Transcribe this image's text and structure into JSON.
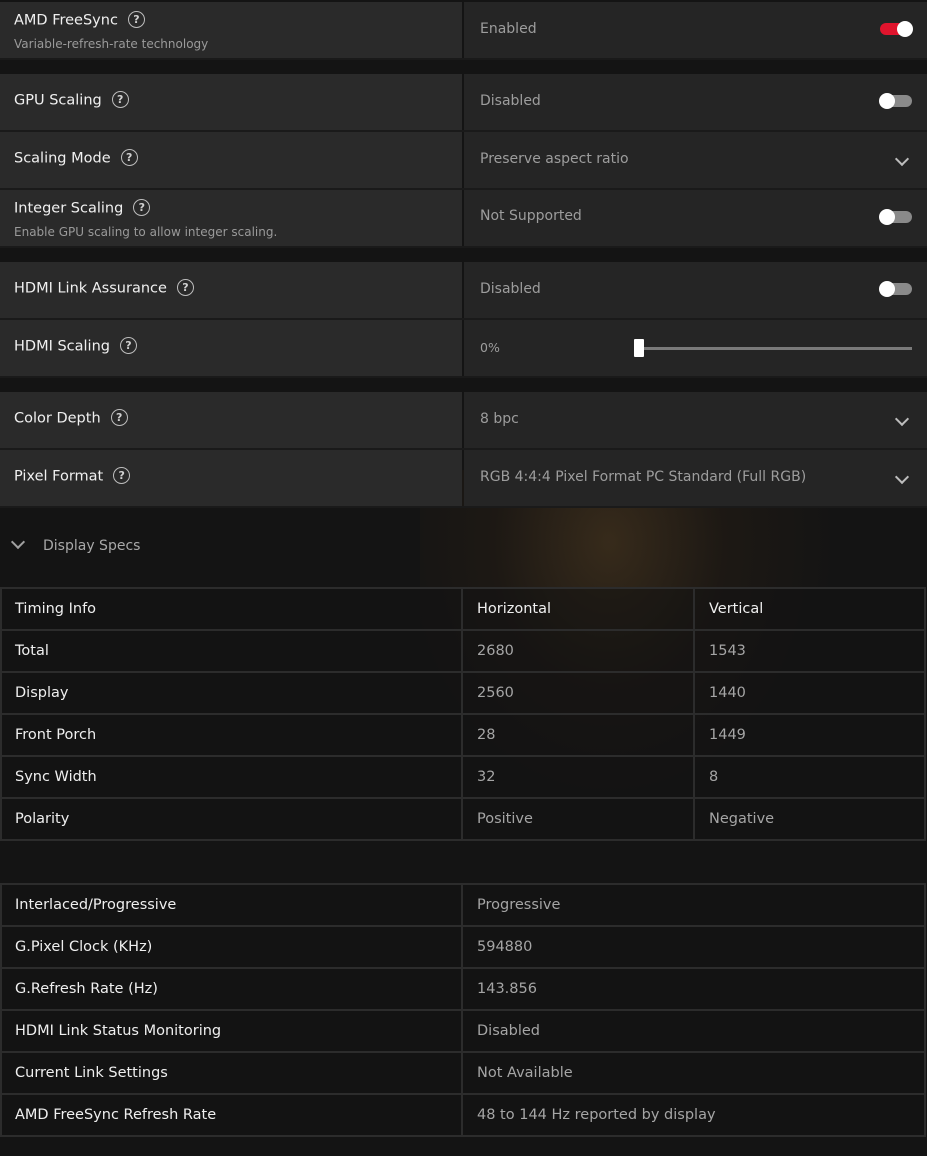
{
  "settings": {
    "freesync": {
      "title": "AMD FreeSync",
      "subtitle": "Variable-refresh-rate technology",
      "value": "Enabled",
      "toggle": "on"
    },
    "gpu_scaling": {
      "title": "GPU Scaling",
      "value": "Disabled",
      "toggle": "off"
    },
    "scaling_mode": {
      "title": "Scaling Mode",
      "value": "Preserve aspect ratio"
    },
    "integer_scaling": {
      "title": "Integer Scaling",
      "subtitle": "Enable GPU scaling to allow integer scaling.",
      "value": "Not Supported",
      "toggle": "off"
    },
    "hdmi_link_assurance": {
      "title": "HDMI Link Assurance",
      "value": "Disabled",
      "toggle": "off"
    },
    "hdmi_scaling": {
      "title": "HDMI Scaling",
      "value": "0%",
      "level": 0
    },
    "color_depth": {
      "title": "Color Depth",
      "value": "8 bpc"
    },
    "pixel_format": {
      "title": "Pixel Format",
      "value": "RGB 4:4:4 Pixel Format PC Standard (Full RGB)"
    }
  },
  "help_glyph": "?",
  "specs": {
    "title": "Display Specs",
    "timing": {
      "headers": [
        "Timing Info",
        "Horizontal",
        "Vertical"
      ],
      "rows": [
        [
          "Total",
          "2680",
          "1543"
        ],
        [
          "Display",
          "2560",
          "1440"
        ],
        [
          "Front Porch",
          "28",
          "1449"
        ],
        [
          "Sync Width",
          "32",
          "8"
        ],
        [
          "Polarity",
          "Positive",
          "Negative"
        ]
      ]
    },
    "info": [
      [
        "Interlaced/Progressive",
        "Progressive"
      ],
      [
        "G.Pixel Clock (KHz)",
        "594880"
      ],
      [
        "G.Refresh Rate (Hz)",
        "143.856"
      ],
      [
        "HDMI Link Status Monitoring",
        "Disabled"
      ],
      [
        "Current Link Settings",
        "Not Available"
      ],
      [
        "AMD FreeSync Refresh Rate",
        "48 to 144 Hz reported by display"
      ]
    ]
  },
  "colors": {
    "accent_on": "#e0142d",
    "panel": "#2a2a2a",
    "background": "#141414"
  }
}
